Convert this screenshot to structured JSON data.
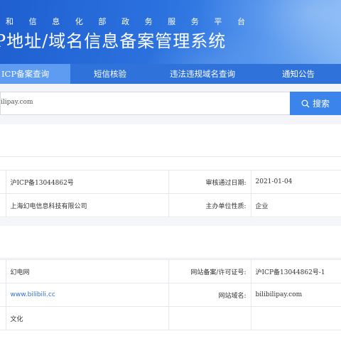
{
  "header": {
    "subtitle_chars": [
      "和",
      "信",
      "息",
      "化",
      "部",
      "政",
      "务",
      "服",
      "务",
      "平",
      "台"
    ],
    "title": "P地址/域名信息备案管理系统"
  },
  "nav": {
    "tabs": [
      {
        "label": "ICP备案查询",
        "active": true
      },
      {
        "label": "短信核验",
        "active": false
      },
      {
        "label": "违法违规域名查询",
        "active": false
      },
      {
        "label": "通知公告",
        "active": false
      }
    ]
  },
  "search": {
    "value": "ilipay.com",
    "button_label": "搜索",
    "button_icon": "search-icon"
  },
  "sponsor": {
    "license_value": "沪ICP备13044862号",
    "review_date_label": "审核通过日期:",
    "review_date_value": "2021-01-04",
    "unit_name": "上海幻电信息科技有限公司",
    "unit_nature_label": "主办单位性质:",
    "unit_nature_value": "企业"
  },
  "website": {
    "name_value": "幻电网",
    "license_label": "网站备案/许可证号:",
    "license_value": "沪ICP备13044862号-1",
    "homepage_value": "www.bilibili.cc",
    "domain_label": "网站域名:",
    "domain_value": "bilibilipay.com",
    "content_value": "文化"
  },
  "colors": {
    "header_blue": "#2b71de",
    "nav_blue": "#2f72d9",
    "active_tab": "#5d9cf0",
    "search_button": "#3a84ec",
    "link": "#2f6fd6"
  }
}
